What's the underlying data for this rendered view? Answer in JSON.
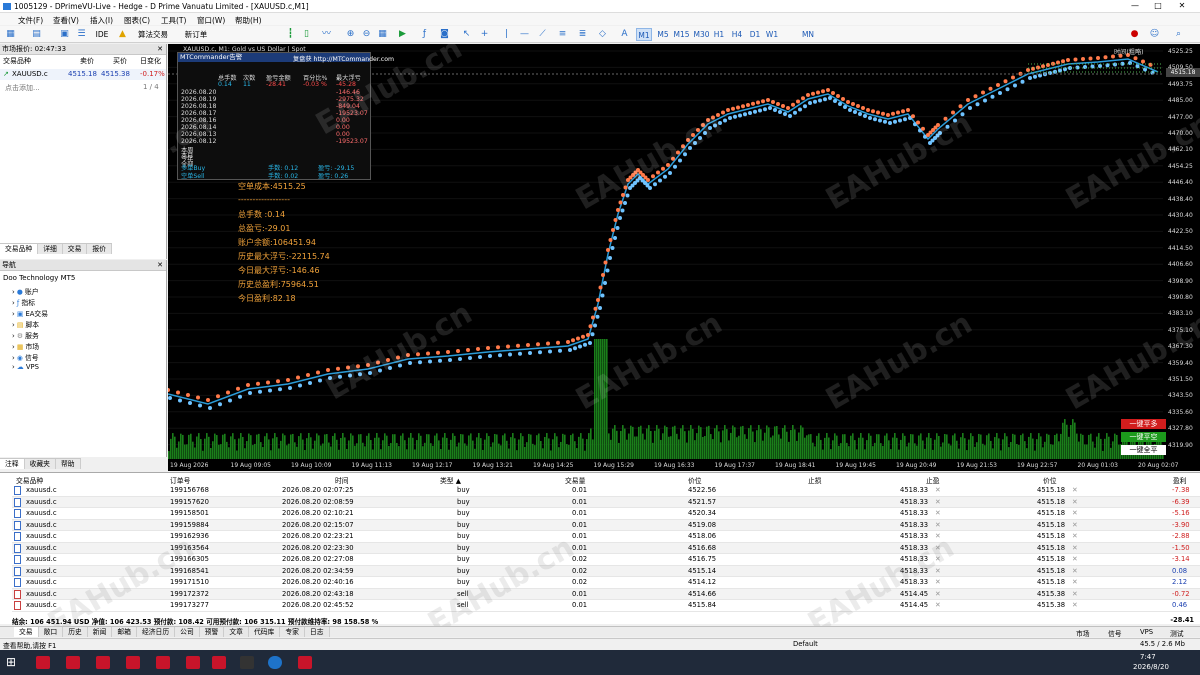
{
  "window": {
    "title": "1005129 - DPrimeVU-Live - Hedge - D Prime Vanuatu Limited - [XAUUSD.c,M1]",
    "min": "—",
    "max": "□",
    "close": "✕"
  },
  "menu": [
    "文件(F)",
    "查看(V)",
    "插入(I)",
    "图表(C)",
    "工具(T)",
    "窗口(W)",
    "帮助(H)"
  ],
  "toolbar": {
    "ide": "IDE",
    "algo": "算法交易",
    "neworder": "新订单",
    "timeframes": [
      "M1",
      "M5",
      "M15",
      "M30",
      "H1",
      "H4",
      "D1",
      "W1",
      "MN"
    ],
    "active_tf": "M1"
  },
  "market_watch": {
    "title": "市场报价: 02:47:33",
    "cols": [
      "交易品种",
      "卖价",
      "买价",
      "日变化"
    ],
    "rows": [
      {
        "symbol": "XAUUSD.c",
        "bid": "4515.18",
        "ask": "4515.38",
        "change": "-0.17%"
      }
    ],
    "add": "点击添加...",
    "count": "1 / 4",
    "tabs": [
      "交易品种",
      "详细",
      "交易",
      "报价"
    ]
  },
  "navigator": {
    "title": "导航",
    "broker": "Doo Technology MT5",
    "items": [
      "账户",
      "指标",
      "EA交易",
      "脚本",
      "服务",
      "市场",
      "信号",
      "VPS"
    ],
    "tabs": [
      "注释",
      "收藏夹",
      "帮助"
    ]
  },
  "chart": {
    "header": "XAUUSD.c, M1: Gold vs US Dollar | Spot",
    "oneclick": "一键平多",
    "oneclick2": "一键平空",
    "oneclick3": "一键全平",
    "ea_label": "时间(粗略)",
    "y_ticks": [
      "4525.25",
      "4509.50",
      "4493.75",
      "4485.00",
      "4477.00",
      "4470.00",
      "4462.10",
      "4454.25",
      "4446.40",
      "4438.40",
      "4430.40",
      "4422.50",
      "4414.50",
      "4406.60",
      "4398.90",
      "4390.80",
      "4383.10",
      "4375.10",
      "4367.30",
      "4359.40",
      "4351.50",
      "4343.50",
      "4335.60",
      "4327.80",
      "4319.90"
    ],
    "x_ticks": [
      "19 Aug 2026",
      "19 Aug 09:05",
      "19 Aug 10:09",
      "19 Aug 11:13",
      "19 Aug 12:17",
      "19 Aug 13:21",
      "19 Aug 14:25",
      "19 Aug 15:29",
      "19 Aug 16:33",
      "19 Aug 17:37",
      "19 Aug 18:41",
      "19 Aug 19:45",
      "19 Aug 20:49",
      "19 Aug 21:53",
      "19 Aug 22:57",
      "20 Aug 01:03",
      "20 Aug 02:07"
    ],
    "price_tag": "4515.18"
  },
  "mtc": {
    "title": "MTCommander告警",
    "url": "复盘获 http://MTCommander.com",
    "headers": [
      "总手数",
      "次数",
      "盈亏金额",
      "百分比%",
      "最大浮亏"
    ],
    "summary": [
      "0.14",
      "11",
      "-28.41",
      "-0.03 %",
      "-45.28"
    ],
    "dates": [
      "2026.08.20",
      "2026.08.19",
      "2026.08.18",
      "2026.08.17",
      "2026.08.16",
      "2026.08.14",
      "2026.08.13",
      "2026.08.12"
    ],
    "vals": [
      "-146.46",
      "-2975.32",
      "-849.04",
      "-19523.07",
      "0.00",
      "0.00",
      "0.00",
      "-19523.07"
    ],
    "labels": [
      "本周",
      "本月",
      "今年",
      "全部"
    ],
    "buy": "多单Buy",
    "sell": "空单Sell",
    "buylots": "手数: 0.12",
    "selllots": "手数: 0.02",
    "buypl": "盈亏: -29.15",
    "sellpl": "盈亏: 0.26"
  },
  "info": [
    "空单成本:4515.25",
    "------------------",
    "总手数 :0.14",
    "总盈亏:-29.01",
    "账户余额:106451.94",
    "历史最大浮亏:-22115.74",
    "今日最大浮亏:-146.46",
    "历史总盈利:75964.51",
    "今日盈利:82.18"
  ],
  "trade": {
    "cols": [
      "交易品种",
      "订单号",
      "时间",
      "类型 ▲",
      "交易量",
      "价位",
      "止损",
      "止盈",
      "价位",
      "盈利"
    ],
    "rows": [
      {
        "sym": "xauusd.c",
        "id": "199156768",
        "time": "2026.08.20 02:07:25",
        "type": "buy",
        "vol": "0.01",
        "price": "4522.56",
        "tp": "4518.33",
        "cur": "4515.18",
        "pl": "-7.38"
      },
      {
        "sym": "xauusd.c",
        "id": "199157620",
        "time": "2026.08.20 02:08:59",
        "type": "buy",
        "vol": "0.01",
        "price": "4521.57",
        "tp": "4518.33",
        "cur": "4515.18",
        "pl": "-6.39"
      },
      {
        "sym": "xauusd.c",
        "id": "199158501",
        "time": "2026.08.20 02:10:21",
        "type": "buy",
        "vol": "0.01",
        "price": "4520.34",
        "tp": "4518.33",
        "cur": "4515.18",
        "pl": "-5.16"
      },
      {
        "sym": "xauusd.c",
        "id": "199159884",
        "time": "2026.08.20 02:15:07",
        "type": "buy",
        "vol": "0.01",
        "price": "4519.08",
        "tp": "4518.33",
        "cur": "4515.18",
        "pl": "-3.90"
      },
      {
        "sym": "xauusd.c",
        "id": "199162936",
        "time": "2026.08.20 02:23:21",
        "type": "buy",
        "vol": "0.01",
        "price": "4518.06",
        "tp": "4518.33",
        "cur": "4515.18",
        "pl": "-2.88"
      },
      {
        "sym": "xauusd.c",
        "id": "199163564",
        "time": "2026.08.20 02:23:30",
        "type": "buy",
        "vol": "0.01",
        "price": "4516.68",
        "tp": "4518.33",
        "cur": "4515.18",
        "pl": "-1.50"
      },
      {
        "sym": "xauusd.c",
        "id": "199166305",
        "time": "2026.08.20 02:27:08",
        "type": "buy",
        "vol": "0.02",
        "price": "4516.75",
        "tp": "4518.33",
        "cur": "4515.18",
        "pl": "-3.14"
      },
      {
        "sym": "xauusd.c",
        "id": "199168541",
        "time": "2026.08.20 02:34:59",
        "type": "buy",
        "vol": "0.02",
        "price": "4515.14",
        "tp": "4518.33",
        "cur": "4515.18",
        "pl": "0.08"
      },
      {
        "sym": "xauusd.c",
        "id": "199171510",
        "time": "2026.08.20 02:40:16",
        "type": "buy",
        "vol": "0.02",
        "price": "4514.12",
        "tp": "4518.33",
        "cur": "4515.18",
        "pl": "2.12"
      },
      {
        "sym": "xauusd.c",
        "id": "199172372",
        "time": "2026.08.20 02:43:18",
        "type": "sell",
        "vol": "0.01",
        "price": "4514.66",
        "tp": "4514.45",
        "cur": "4515.38",
        "pl": "-0.72"
      },
      {
        "sym": "xauusd.c",
        "id": "199173277",
        "time": "2026.08.20 02:45:52",
        "type": "sell",
        "vol": "0.01",
        "price": "4515.84",
        "tp": "4514.45",
        "cur": "4515.38",
        "pl": "0.46"
      }
    ],
    "balance": "结余: 106 451.94 USD  净值: 106 423.53  预付款: 108.42  可用预付款: 106 315.11  预付款维持率: 98 158.58 %",
    "total": "-28.41"
  },
  "bottom_tabs": [
    "交易",
    "敞口",
    "历史",
    "新闻",
    "邮箱",
    "经济日历",
    "公司",
    "预警",
    "文章",
    "代码库",
    "专家",
    "日志"
  ],
  "bottom_right": [
    "市场",
    "信号",
    "VPS",
    "测试"
  ],
  "status": {
    "left": "查看帮助,请按 F1",
    "default": "Default",
    "traffic": "45.5 / 2.6 Mb"
  },
  "taskbar": {
    "time": "7:47",
    "date": "2026/8/20"
  },
  "watermark": "EAHub.cn"
}
